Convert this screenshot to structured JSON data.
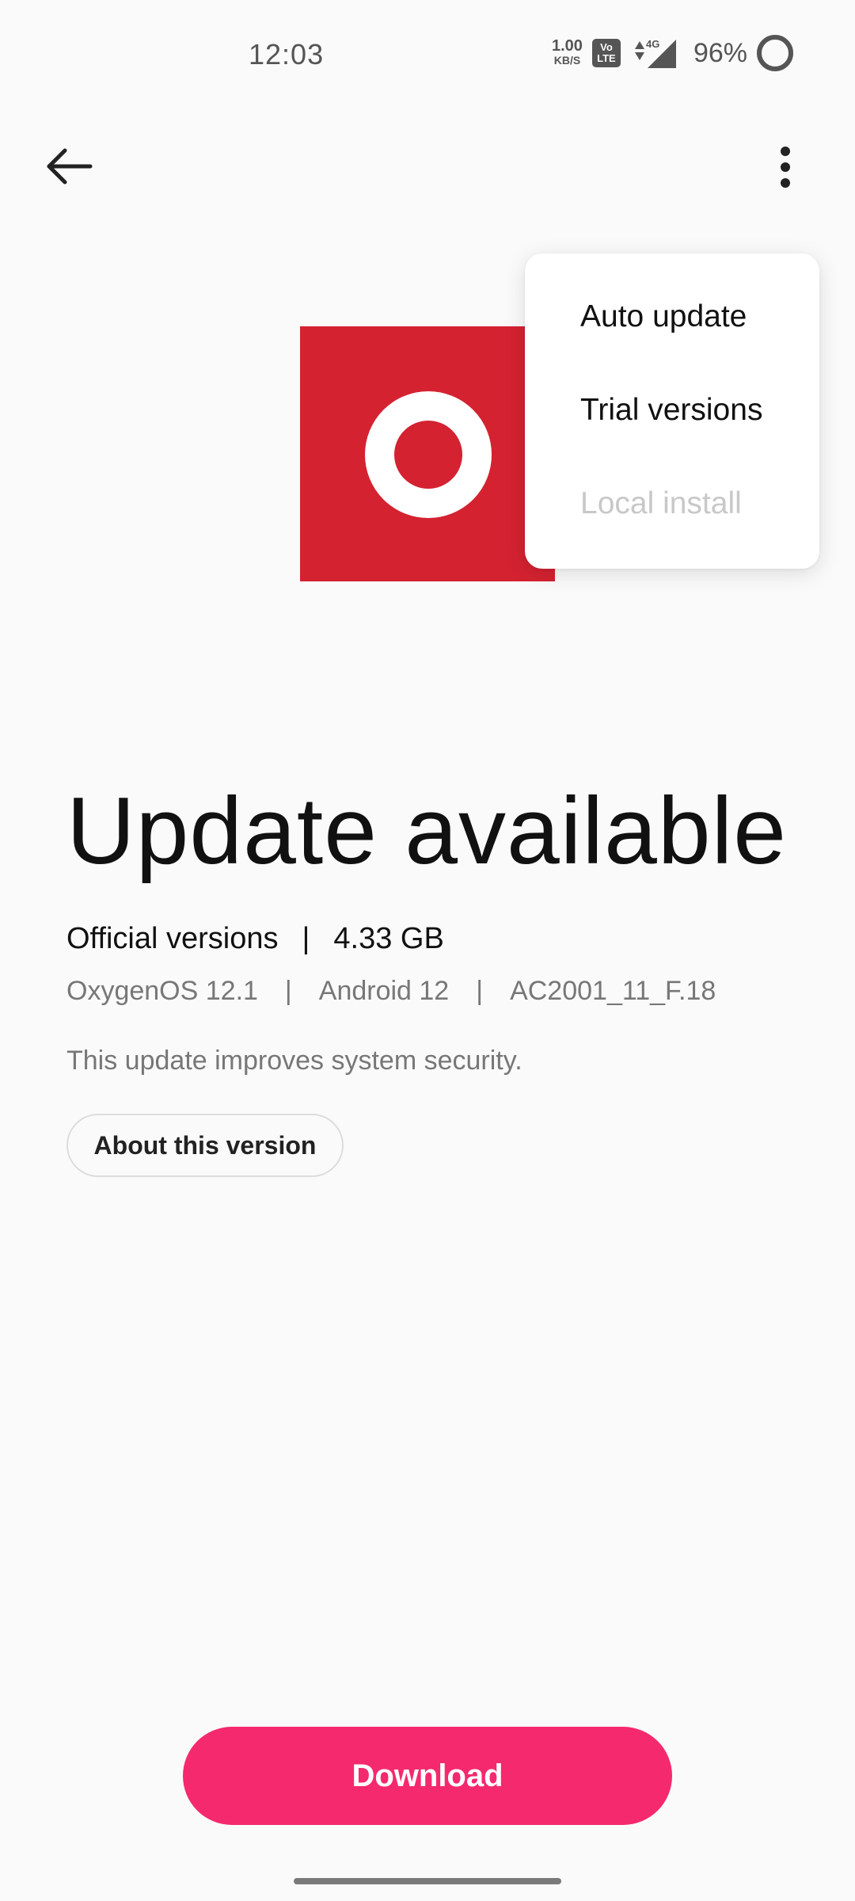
{
  "status_bar": {
    "time": "12:03",
    "speed_value": "1.00",
    "speed_unit": "KB/S",
    "volte_top": "Vo",
    "volte_bottom": "LTE",
    "network": "4G",
    "battery": "96%"
  },
  "menu": {
    "items": [
      {
        "label": "Auto update",
        "enabled": true
      },
      {
        "label": "Trial versions",
        "enabled": true
      },
      {
        "label": "Local install",
        "enabled": false
      }
    ]
  },
  "update": {
    "title": "Update available",
    "channel": "Official versions",
    "separator": "|",
    "size": "4.33 GB",
    "os": "OxygenOS 12.1",
    "android": "Android 12",
    "build": "AC2001_11_F.18",
    "description": "This update improves system security.",
    "about_label": "About this version"
  },
  "actions": {
    "download_label": "Download"
  },
  "colors": {
    "accent": "#f5296e",
    "logo_red": "#d42231",
    "background": "#fafafa"
  }
}
